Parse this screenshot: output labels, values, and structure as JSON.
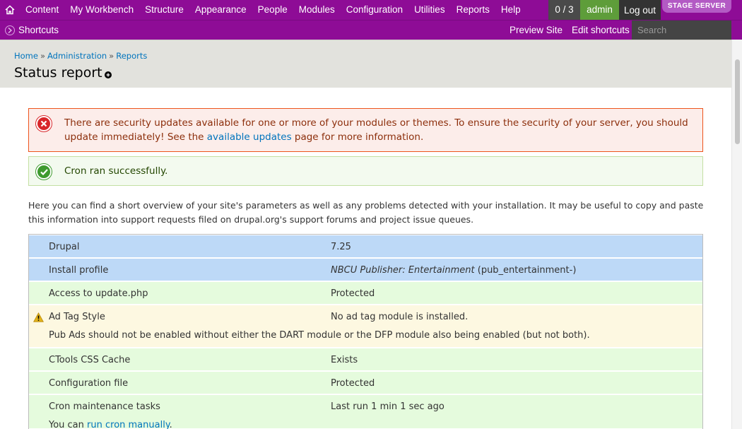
{
  "toolbar": {
    "menu": [
      "Content",
      "My Workbench",
      "Structure",
      "Appearance",
      "People",
      "Modules",
      "Configuration",
      "Utilities",
      "Reports",
      "Help"
    ],
    "counter": "0 / 3",
    "username": "admin",
    "logout": "Log out",
    "environment": "STAGE SERVER",
    "colors": {
      "toolbar_bg": "#8e0c96",
      "user_bg": "#5e9d3a",
      "badge_bg": "#b35ac4"
    }
  },
  "shortcuts": {
    "toggle": "Shortcuts",
    "links": [
      "Preview Site",
      "Edit shortcuts"
    ],
    "search_placeholder": "Search"
  },
  "header": {
    "breadcrumb": [
      "Home",
      "Administration",
      "Reports"
    ],
    "breadcrumb_separator": "»",
    "title": "Status report"
  },
  "messages": {
    "error": {
      "before": "There are security updates available for one or more of your modules or themes. To ensure the security of your server, you should update immediately! See the ",
      "link": "available updates",
      "after": " page for more information."
    },
    "status": "Cron ran successfully."
  },
  "intro": "Here you can find a short overview of your site's parameters as well as any problems detected with your installation. It may be useful to copy and paste this information into support requests filed on drupal.org's support forums and project issue queues.",
  "status_rows": [
    {
      "title": "Drupal",
      "value": "7.25",
      "severity": "info"
    },
    {
      "title": "Install profile",
      "value_italic": "NBCU Publisher: Entertainment",
      "value_rest": " (pub_entertainment-)",
      "severity": "info"
    },
    {
      "title": "Access to update.php",
      "value": "Protected",
      "severity": "ok"
    },
    {
      "title": "Ad Tag Style",
      "value": "No ad tag module is installed.",
      "description": "Pub Ads should not be enabled without either the DART module or the DFP module also being enabled (but not both).",
      "severity": "warning"
    },
    {
      "title": "CTools CSS Cache",
      "value": "Exists",
      "severity": "ok"
    },
    {
      "title": "Configuration file",
      "value": "Protected",
      "severity": "ok"
    },
    {
      "title": "Cron maintenance tasks",
      "value": "Last run 1 min 1 sec ago",
      "description_before": "You can ",
      "description_link": "run cron manually",
      "description_after": ".",
      "severity": "ok"
    }
  ]
}
